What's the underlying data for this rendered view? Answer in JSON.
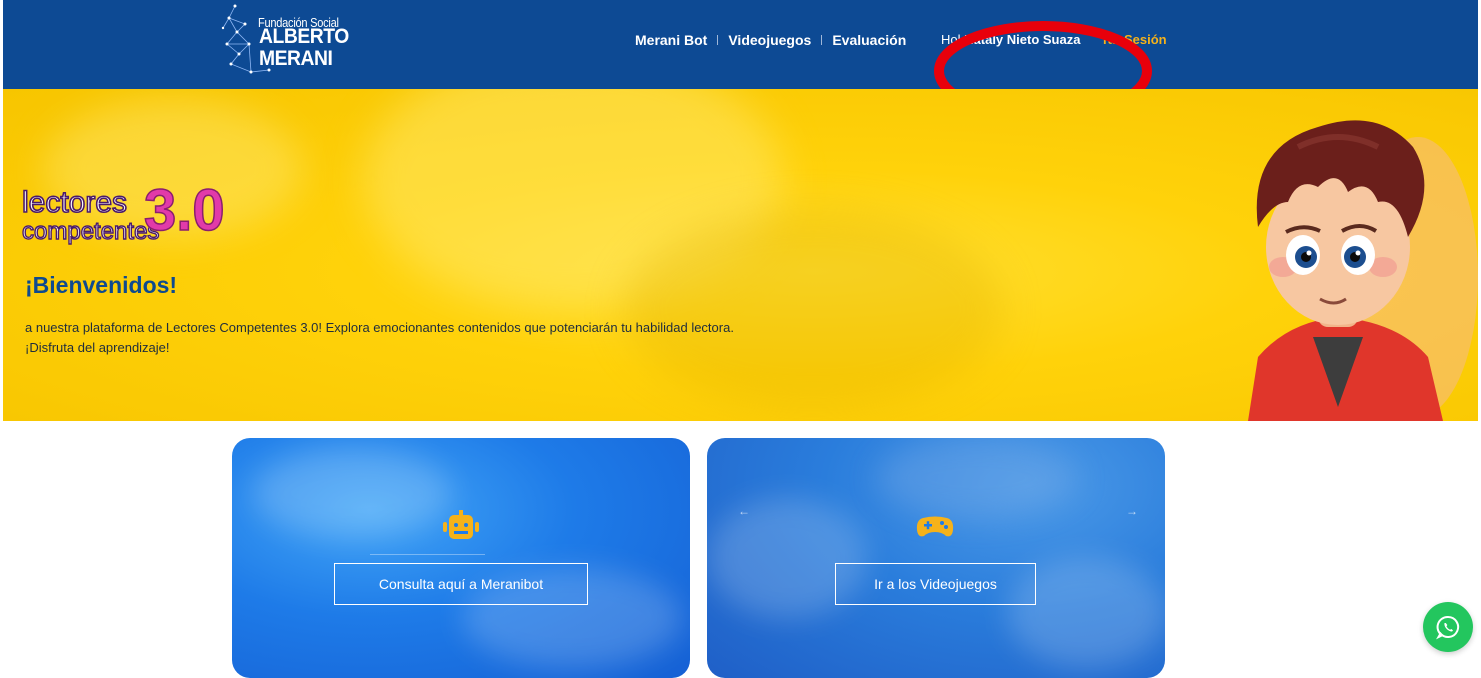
{
  "brand": {
    "small": "Fundación Social",
    "big": "ALBERTO MERANI"
  },
  "nav": {
    "items": [
      {
        "label": "Merani Bot"
      },
      {
        "label": "Videojuegos"
      },
      {
        "label": "Evaluación"
      }
    ],
    "greeting_prefix": "Hol",
    "user_name": "Nataly Nieto Suaza",
    "logout": "rar Sesión"
  },
  "hero": {
    "logo_line1": "lectores",
    "logo_line2": "competentes",
    "logo_version": "3.0",
    "title": "¡Bienvenidos!",
    "description": "a nuestra plataforma de Lectores Competentes 3.0! Explora emocionantes contenidos que potenciarán tu habilidad lectora. ¡Disfruta del aprendizaje!"
  },
  "cards": [
    {
      "icon": "robot-icon",
      "button": "Consulta aquí a Meranibot"
    },
    {
      "icon": "gamepad-icon",
      "button": "Ir a los Videojuegos",
      "prev": "←",
      "next": "→"
    }
  ],
  "colors": {
    "header": "#0d4a94",
    "hero": "#ffd20a",
    "title": "#0e4a8f",
    "card": "#1e7be8",
    "accent": "#f5b21a",
    "annotation": "#e8000b",
    "whatsapp": "#23c65e"
  },
  "floating": {
    "icon": "whatsapp-icon"
  }
}
